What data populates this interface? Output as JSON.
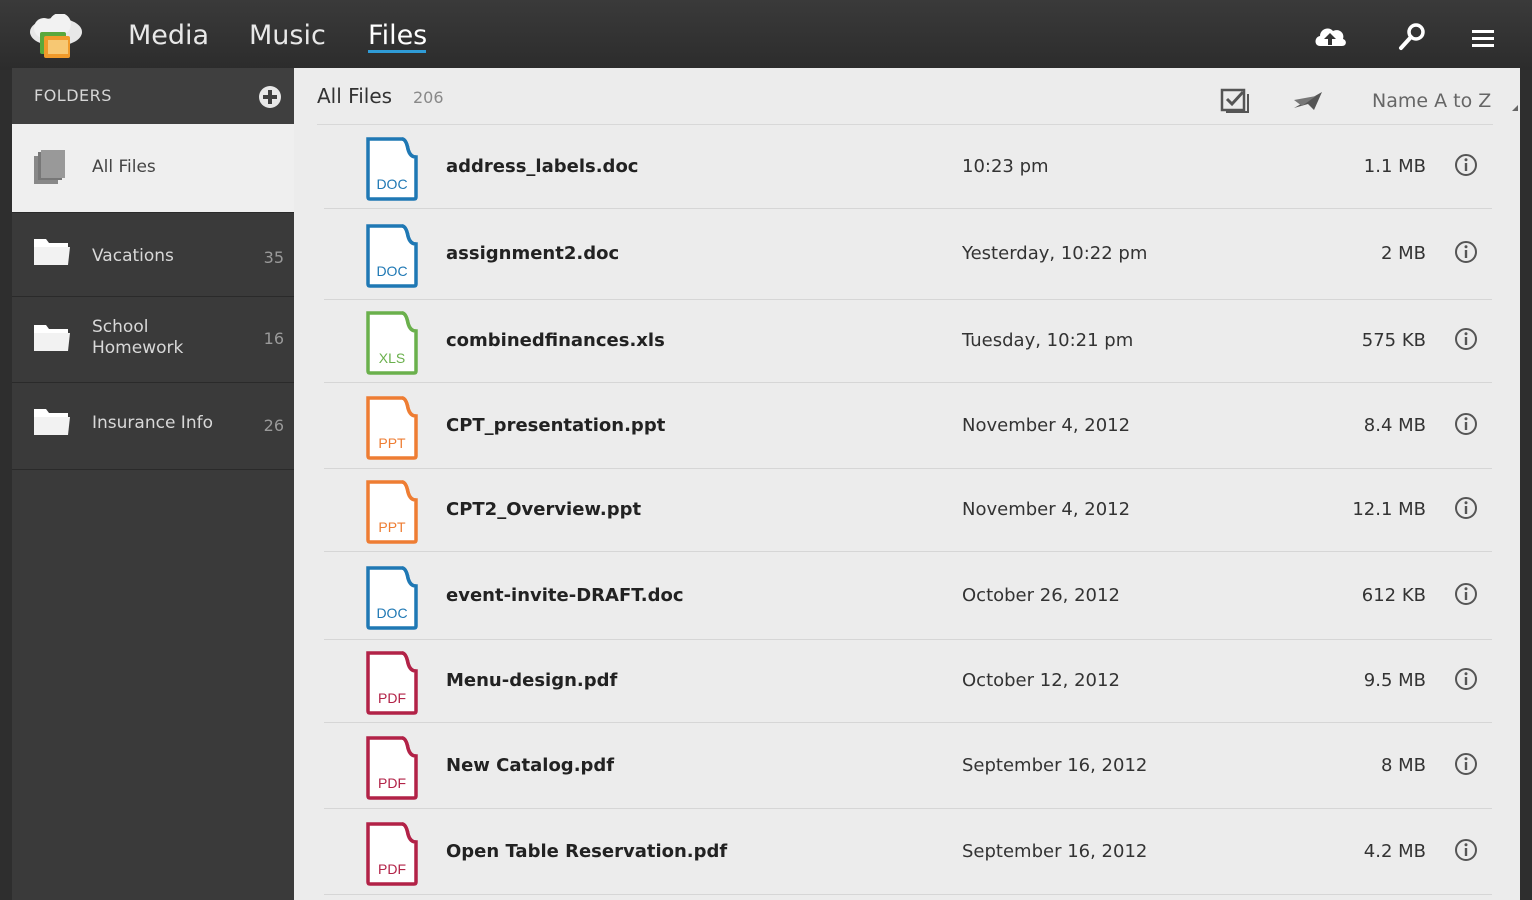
{
  "nav": {
    "tabs": [
      "Media",
      "Music",
      "Files"
    ],
    "active": "Files"
  },
  "sidebar": {
    "header": "FOLDERS",
    "items": [
      {
        "label": "All Files",
        "count": "",
        "icon": "files-stack-icon"
      },
      {
        "label": "Vacations",
        "count": "35",
        "icon": "folder-icon"
      },
      {
        "label_line1": "School",
        "label_line2": "Homework",
        "count": "16",
        "icon": "folder-icon"
      },
      {
        "label": "Insurance Info",
        "count": "26",
        "icon": "folder-icon"
      }
    ]
  },
  "main": {
    "title": "All Files",
    "count": "206",
    "sort": "Name A to Z",
    "files": [
      {
        "name": "address_labels.doc",
        "date": "10:23 pm",
        "size": "1.1 MB",
        "type": "DOC"
      },
      {
        "name": "assignment2.doc",
        "date": "Yesterday, 10:22 pm",
        "size": "2 MB",
        "type": "DOC"
      },
      {
        "name": "combinedfinances.xls",
        "date": "Tuesday, 10:21 pm",
        "size": "575 KB",
        "type": "XLS"
      },
      {
        "name": "CPT_presentation.ppt",
        "date": "November 4, 2012",
        "size": "8.4 MB",
        "type": "PPT"
      },
      {
        "name": "CPT2_Overview.ppt",
        "date": "November 4, 2012",
        "size": "12.1 MB",
        "type": "PPT"
      },
      {
        "name": "event-invite-DRAFT.doc",
        "date": "October 26, 2012",
        "size": "612 KB",
        "type": "DOC"
      },
      {
        "name": "Menu-design.pdf",
        "date": "October 12, 2012",
        "size": "9.5 MB",
        "type": "PDF"
      },
      {
        "name": "New Catalog.pdf",
        "date": "September 16, 2012",
        "size": "8 MB",
        "type": "PDF"
      },
      {
        "name": "Open Table Reservation.pdf",
        "date": "September 16, 2012",
        "size": "4.2 MB",
        "type": "PDF"
      }
    ]
  },
  "colors": {
    "DOC": "#1f78b4",
    "XLS": "#6ab04c",
    "PPT": "#ee7d33",
    "PDF": "#b22247",
    "active_tab_underline": "#2f9bd6"
  }
}
